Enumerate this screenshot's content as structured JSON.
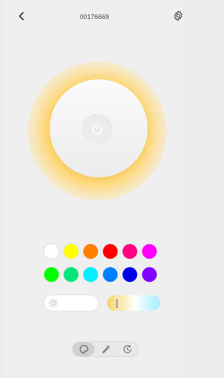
{
  "header": {
    "title": "00176669",
    "back_icon": "chevron-left-icon",
    "settings_icon": "gear-icon"
  },
  "light": {
    "power_icon": "power-icon",
    "glow_color": "#ffd36b"
  },
  "palette": [
    "#ffffff",
    "#ffff00",
    "#ff7f00",
    "#ff0000",
    "#ff0080",
    "#ff00ff",
    "#00ff00",
    "#00e67a",
    "#00f0ff",
    "#0080ff",
    "#0000e6",
    "#8000ff"
  ],
  "controls": {
    "brightness_icon": "sun-icon",
    "color_temperature_level": 0.17
  },
  "mode_bar": {
    "items": [
      {
        "icon": "palette-icon",
        "active": true
      },
      {
        "icon": "eyedropper-icon",
        "active": false
      },
      {
        "icon": "timer-icon",
        "active": false
      }
    ]
  }
}
